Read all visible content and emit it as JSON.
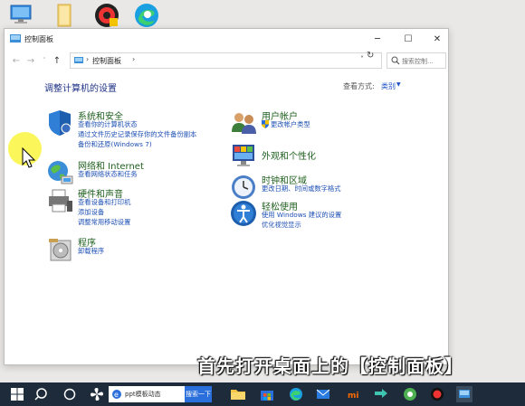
{
  "window": {
    "title": "控制面板",
    "min_glyph": "─",
    "max_glyph": "☐",
    "close_glyph": "✕"
  },
  "address": {
    "back_glyph": "←",
    "forward_glyph": "→",
    "history_glyph": "˅",
    "up_glyph": "↑",
    "sep1": "›",
    "crumb": "控制面板",
    "sep2": "›",
    "dropdown_glyph": "˅",
    "refresh_glyph": "↻",
    "search_placeholder": "搜索控制..."
  },
  "content": {
    "heading": "调整计算机的设置",
    "view_by_label": "查看方式:",
    "view_by_value": "类别",
    "view_by_dd": "▼"
  },
  "categories_left": [
    {
      "title": "系统和安全",
      "links": [
        "查看你的计算机状态",
        "通过文件历史记录保存你的文件备份副本",
        "备份和还原(Windows 7)"
      ]
    },
    {
      "title": "网络和 Internet",
      "links": [
        "查看网络状态和任务"
      ]
    },
    {
      "title": "硬件和声音",
      "links": [
        "查看设备和打印机",
        "添加设备",
        "调整常用移动设置"
      ]
    },
    {
      "title": "程序",
      "links": [
        "卸载程序"
      ]
    }
  ],
  "categories_right": [
    {
      "title": "用户帐户",
      "links": [
        "更改帐户类型"
      ]
    },
    {
      "title": "外观和个性化",
      "links": []
    },
    {
      "title": "时钟和区域",
      "links": [
        "更改日期、时间或数字格式"
      ]
    },
    {
      "title": "轻松使用",
      "links": [
        "使用 Windows 建议的设置",
        "优化视觉显示"
      ]
    }
  ],
  "caption": "首先打开桌面上的【控制面板】",
  "taskbar": {
    "search_text": "ppt模板动态",
    "search_button": "搜索一下"
  },
  "colors": {
    "category_title": "#1f5f1f",
    "link": "#1e50b4",
    "heading": "#1e3287",
    "taskbar": "#1e2b3a"
  }
}
